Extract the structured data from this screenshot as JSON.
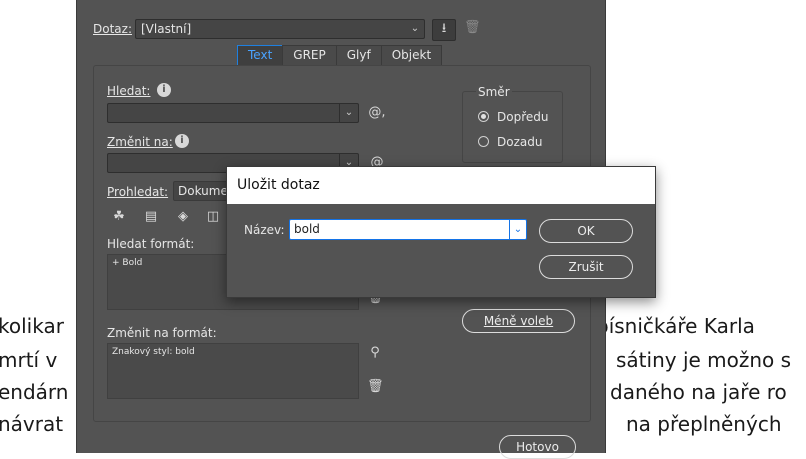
{
  "background_text": [
    {
      "left": "kolikar",
      "right": "písničkáře Karla"
    },
    {
      "left": "mrtí v",
      "right": "sátiny je možno s"
    },
    {
      "left": "endárn",
      "right": "daného na jaře ro"
    },
    {
      "left": "návrat",
      "right": "na přeplněných"
    }
  ],
  "dialog": {
    "query_label": "Dotaz:",
    "query_value": "[Vlastní]",
    "tabs": [
      "Text",
      "GREP",
      "Glyf",
      "Objekt"
    ],
    "find_label": "Hledat:",
    "change_label": "Změnit na:",
    "search_label": "Prohledat:",
    "search_value": "Dokumen",
    "direction": {
      "title": "Směr",
      "options": [
        "Dopředu",
        "Dozadu"
      ],
      "selected": "Dopředu"
    },
    "find_format_label": "Hledat formát:",
    "find_format_value": "+ Bold",
    "change_format_label": "Změnit na formát:",
    "change_format_value": "Znakový styl: bold",
    "fewer_options_label": "Méně voleb",
    "done_label": "Hotovo"
  },
  "modal": {
    "title": "Uložit dotaz",
    "name_label": "Název:",
    "name_value": "bold",
    "ok_label": "OK",
    "cancel_label": "Zrušit"
  },
  "colors": {
    "dialog_bg": "#535353",
    "accent": "#1473e6",
    "tab_active": "#4aa3ff"
  }
}
